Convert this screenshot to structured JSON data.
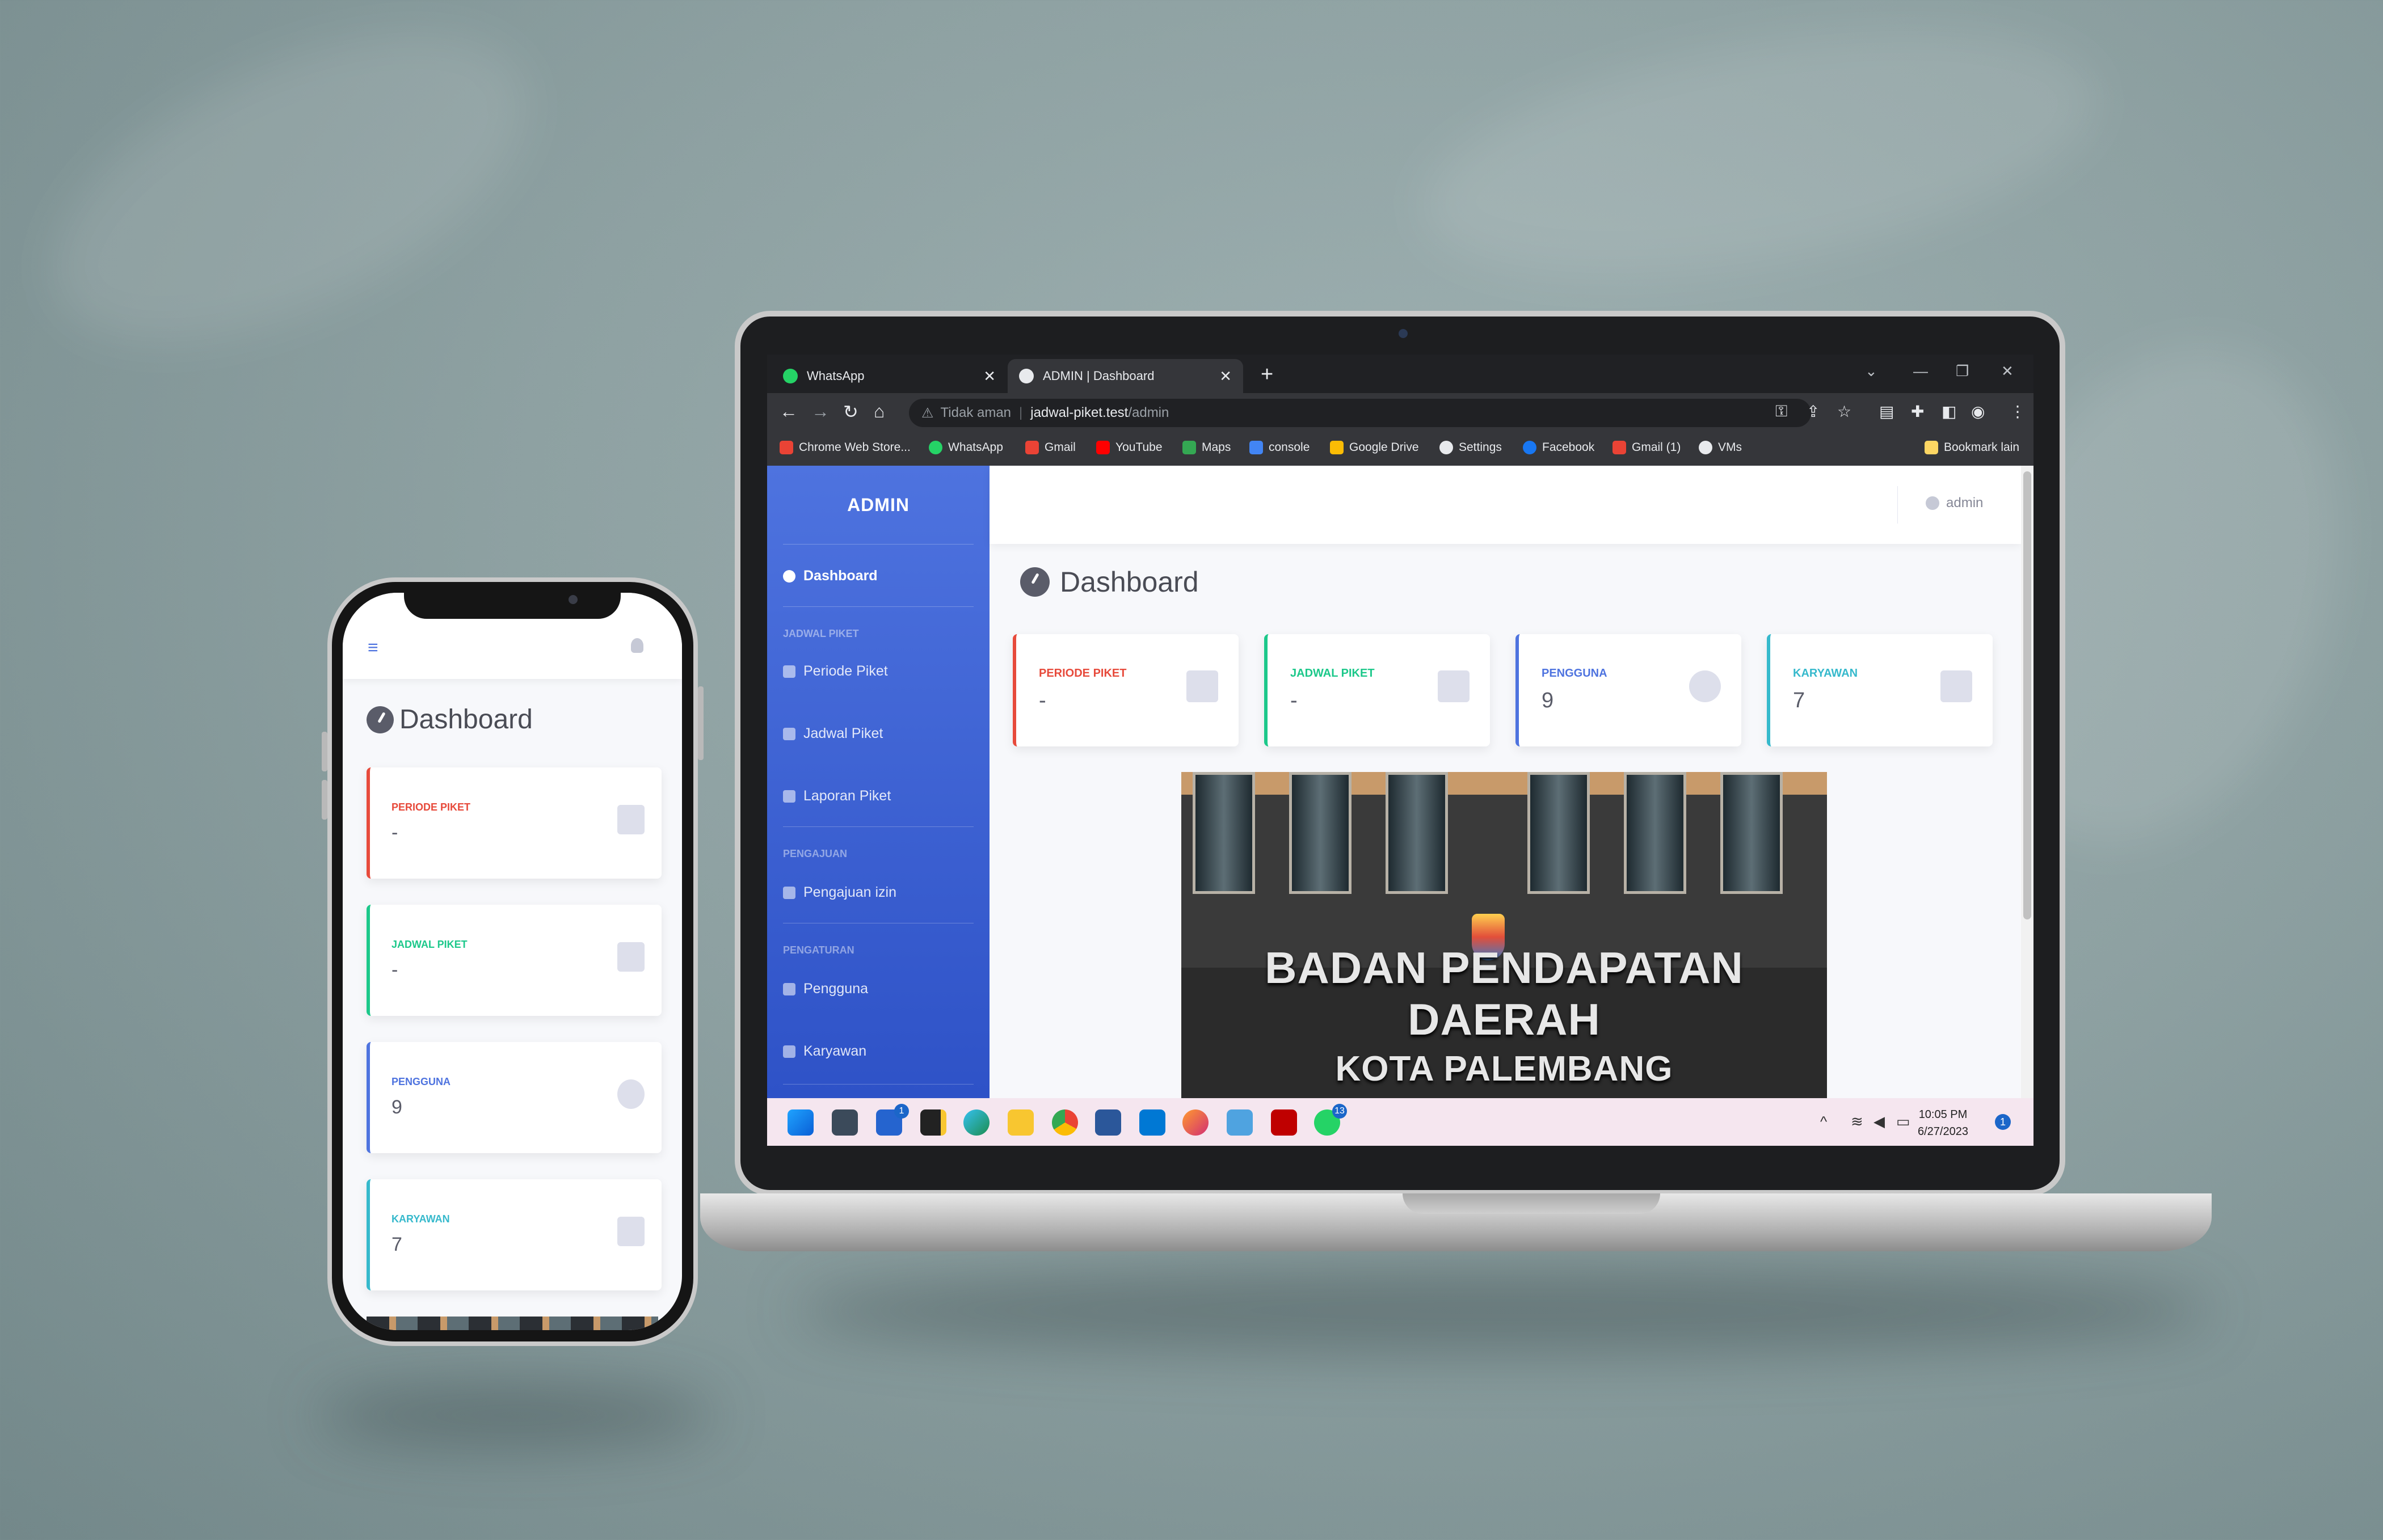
{
  "browser": {
    "tabs": [
      {
        "title": "WhatsApp",
        "close": "✕",
        "favicon_color": "#25d366"
      },
      {
        "title": "ADMIN | Dashboard",
        "close": "✕",
        "favicon_color": "#e8eaed"
      }
    ],
    "new_tab": "+",
    "window_controls": {
      "dropdown": "⌄",
      "minimize": "—",
      "restore": "❐",
      "close": "✕"
    },
    "nav": {
      "back": "←",
      "forward": "→",
      "reload": "↻",
      "home": "⌂"
    },
    "security_icon": "⚠",
    "security_label": "Tidak aman",
    "url_host": "jadwal-piket.test",
    "url_path": "/admin",
    "bookmarks": [
      {
        "label": "Chrome Web Store...",
        "color": "#ea4335"
      },
      {
        "label": "WhatsApp",
        "color": "#25d366"
      },
      {
        "label": "Gmail",
        "color": "#ea4335"
      },
      {
        "label": "YouTube",
        "color": "#ff0000"
      },
      {
        "label": "Maps",
        "color": "#34a853"
      },
      {
        "label": "console",
        "color": "#4285f4"
      },
      {
        "label": "Google Drive",
        "color": "#fbbc05"
      },
      {
        "label": "Settings",
        "color": "#e8eaed"
      },
      {
        "label": "Facebook",
        "color": "#1877f2"
      },
      {
        "label": "Gmail (1)",
        "color": "#ea4335"
      },
      {
        "label": "VMs",
        "color": "#e8eaed"
      }
    ],
    "other_bookmarks": "Bookmark lain"
  },
  "sidebar": {
    "brand": "ADMIN",
    "dashboard": "Dashboard",
    "sections": [
      {
        "heading": "JADWAL PIKET",
        "items": [
          "Periode Piket",
          "Jadwal Piket",
          "Laporan Piket"
        ]
      },
      {
        "heading": "PENGAJUAN",
        "items": [
          "Pengajuan izin"
        ]
      },
      {
        "heading": "PENGATURAN",
        "items": [
          "Pengguna",
          "Karyawan"
        ]
      }
    ]
  },
  "topbar": {
    "user": "admin"
  },
  "main": {
    "title": "Dashboard",
    "cards": [
      {
        "label": "PERIODE PIKET",
        "value": "-",
        "color": "#e74a3b",
        "icon": "calendar-icon"
      },
      {
        "label": "JADWAL PIKET",
        "value": "-",
        "color": "#1cc88a",
        "icon": "table-icon"
      },
      {
        "label": "PENGGUNA",
        "value": "9",
        "color": "#4e73df",
        "icon": "users-icon"
      },
      {
        "label": "KARYAWAN",
        "value": "7",
        "color": "#36b9cc",
        "icon": "briefcase-icon"
      }
    ],
    "photo_sign": {
      "line1": "BADAN PENDAPATAN DAERAH",
      "line2": "KOTA PALEMBANG"
    }
  },
  "taskbar": {
    "badges": {
      "todo": "1",
      "whatsapp": "13"
    },
    "time": "10:05 PM",
    "date": "6/27/2023",
    "notifications": "1",
    "tray_icons": [
      "chevron-up-icon",
      "wifi-icon",
      "speaker-icon",
      "battery-icon"
    ]
  },
  "phone": {
    "menu_icon": "≡",
    "title": "Dashboard"
  }
}
